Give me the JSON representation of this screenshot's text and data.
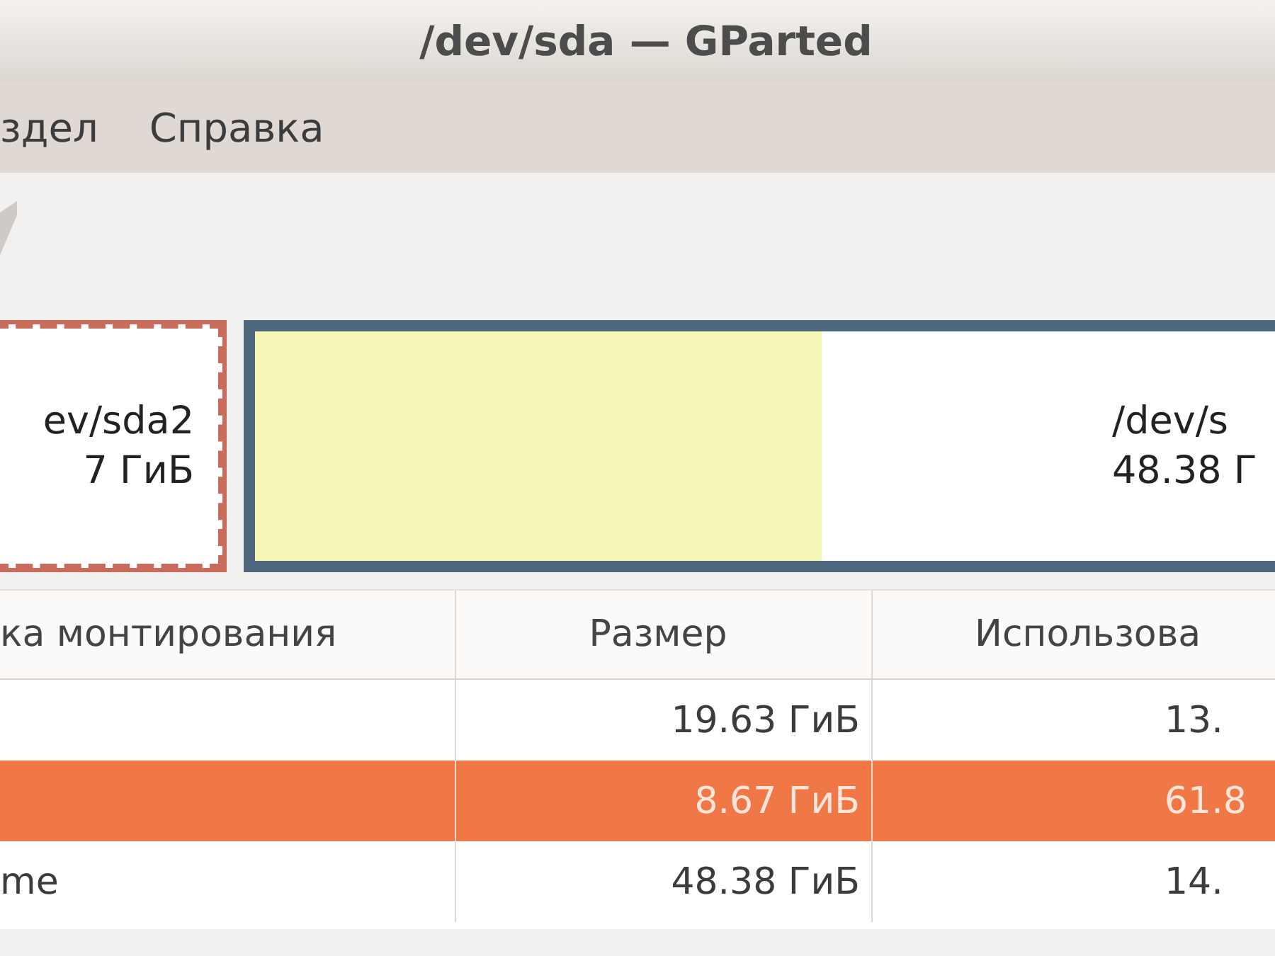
{
  "window": {
    "title": "/dev/sda — GParted"
  },
  "menu": [
    "здел",
    "Справка"
  ],
  "partitions": [
    {
      "name": "ev/sda2",
      "size": "7 ГиБ",
      "selected": true
    },
    {
      "name": "/dev/s",
      "size": "48.38 Г",
      "selected": false,
      "kind": "used"
    }
  ],
  "table": {
    "columns": [
      "ка монтирования",
      "Размер",
      "Использова"
    ],
    "rows": [
      {
        "cells": [
          "",
          "19.63 ГиБ",
          "13."
        ],
        "selected": false
      },
      {
        "cells": [
          "",
          "8.67 ГиБ",
          "61.8"
        ],
        "selected": true
      },
      {
        "cells": [
          "me",
          "48.38 ГиБ",
          "14."
        ],
        "selected": false
      }
    ]
  }
}
